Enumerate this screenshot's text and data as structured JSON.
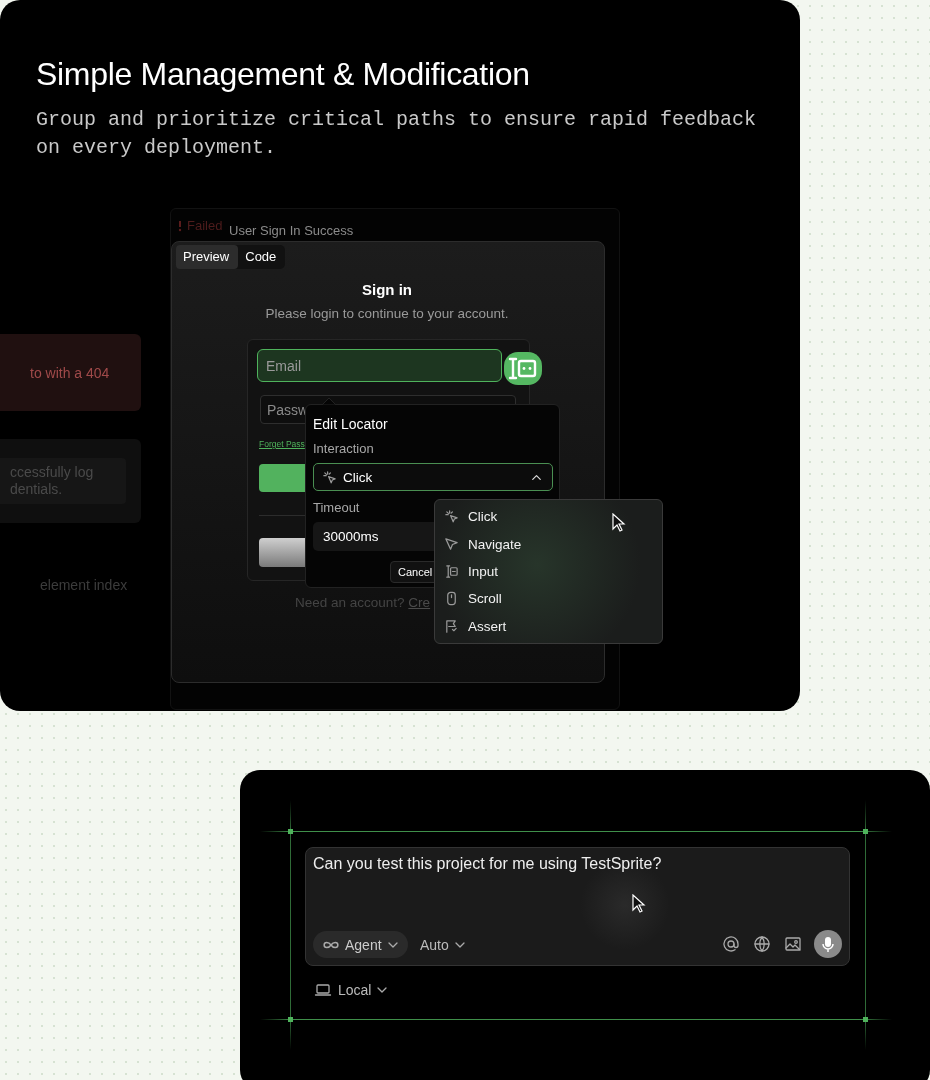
{
  "header": {
    "title": "Simple Management & Modification",
    "subtitle": "Group and prioritize critical paths to ensure rapid feedback on every deployment."
  },
  "background_cards": [
    {
      "kind": "error",
      "text": "to with a 404"
    },
    {
      "kind": "neutral",
      "text": "ccessfully log dentials."
    },
    {
      "kind": "plain",
      "text": "element index"
    }
  ],
  "test_case": {
    "status": "Failed",
    "name": "User Sign In Success"
  },
  "preview": {
    "tabs": [
      {
        "label": "Preview",
        "selected": true
      },
      {
        "label": "Code",
        "selected": false
      }
    ],
    "heading": "Sign in",
    "subheading": "Please login to continue to your account.",
    "email_placeholder": "Email",
    "password_placeholder": "Passw",
    "forgot_link": "Forget Pass",
    "footer_text": "Need an account?",
    "footer_link": "Cre"
  },
  "locator": {
    "title": "Edit Locator",
    "interaction_label": "Interaction",
    "interaction": "Click",
    "expanded": true,
    "timeout_label": "Timeout",
    "timeout": "30000ms",
    "cancel": "Cancel"
  },
  "menu": [
    {
      "kind": "click",
      "label": "Click"
    },
    {
      "kind": "navigate",
      "label": "Navigate"
    },
    {
      "kind": "input",
      "label": "Input"
    },
    {
      "kind": "scroll",
      "label": "Scroll"
    },
    {
      "kind": "assert",
      "label": "Assert"
    }
  ],
  "chat": {
    "message": "Can you test this project for me using TestSprite?",
    "mode": "Agent",
    "model": "Auto",
    "environment": "Local"
  }
}
